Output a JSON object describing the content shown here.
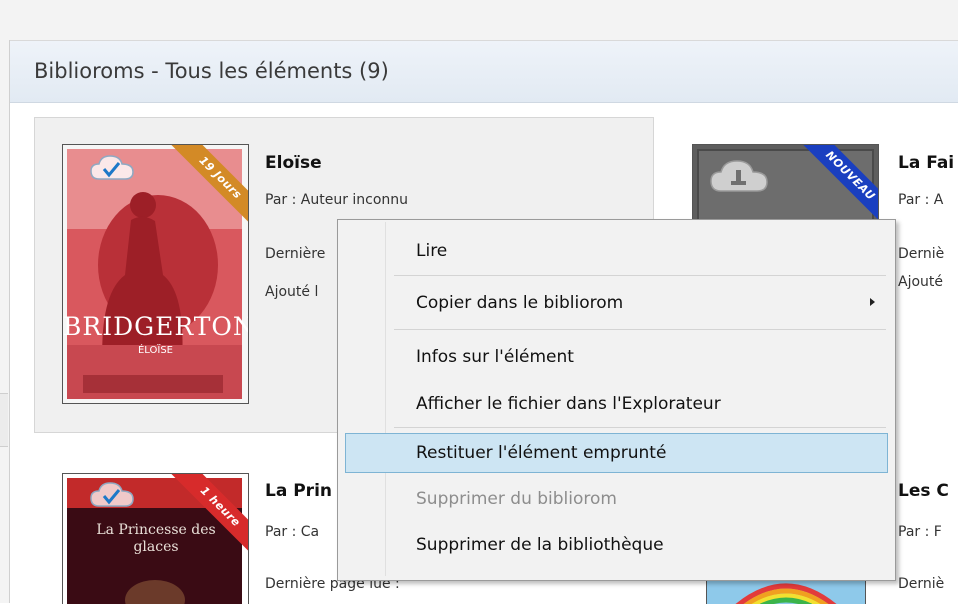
{
  "header": {
    "title": "Biblioroms - Tous les éléments (9)"
  },
  "books": [
    {
      "title": "Eloïse",
      "author": "Par :  Auteur inconnu",
      "last_page": "Dernière",
      "added": "Ajouté l",
      "ribbon": "19 Jours",
      "ribbon_color": "#d38a26",
      "cover_text": "BRIDGERTON",
      "cover_sub": "ÉLOÏSE"
    },
    {
      "title": "La Fai",
      "author": "Par :  A",
      "last_page": "Derniè",
      "added": "Ajouté",
      "ribbon": "NOUVEAU",
      "ribbon_color": "#1a3fc0"
    },
    {
      "title": "La Prin",
      "author": "Par :  Ca",
      "last_page": "Dernière page lue :",
      "ribbon": "1 heure",
      "ribbon_color": "#d72b2b",
      "cover_text": "La Princesse des glaces"
    },
    {
      "title": "Les C",
      "author": "Par :  F",
      "last_page": "Derniè"
    }
  ],
  "context_menu": {
    "items": [
      {
        "label": "Lire"
      },
      {
        "label": "Copier dans le bibliorom"
      },
      {
        "label": "Infos sur l'élément"
      },
      {
        "label": "Afficher le fichier dans l'Explorateur"
      },
      {
        "label": "Restituer l'élément emprunté"
      },
      {
        "label": "Supprimer du bibliorom"
      },
      {
        "label": "Supprimer de la bibliothèque"
      }
    ]
  },
  "colors": {
    "highlight": "#cde5f3",
    "highlight_border": "#7eb4d4",
    "header_bg": "#e6edf5"
  }
}
